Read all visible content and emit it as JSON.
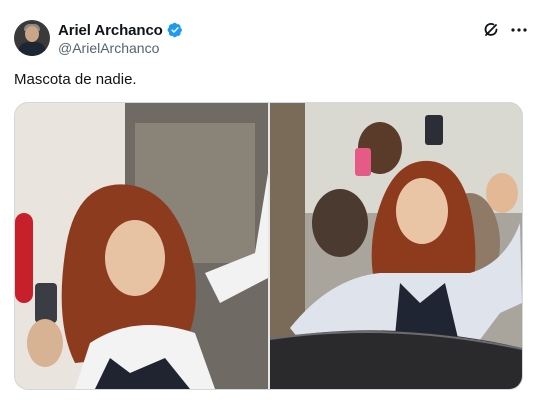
{
  "author": {
    "display_name": "Ariel Archanco",
    "handle": "@ArielArchanco",
    "verified": true,
    "avatar_icon": "profile-avatar"
  },
  "actions": {
    "grok_icon": "grok-icon",
    "more_icon": "more-options-icon"
  },
  "tweet": {
    "text": "Mascota de nadie."
  },
  "media": {
    "photos": [
      {
        "name": "photo-1"
      },
      {
        "name": "photo-2"
      }
    ]
  },
  "colors": {
    "text": "#0f1419",
    "secondary": "#536471",
    "verified_badge": "#1d9bf0",
    "border": "#cfd9de"
  }
}
